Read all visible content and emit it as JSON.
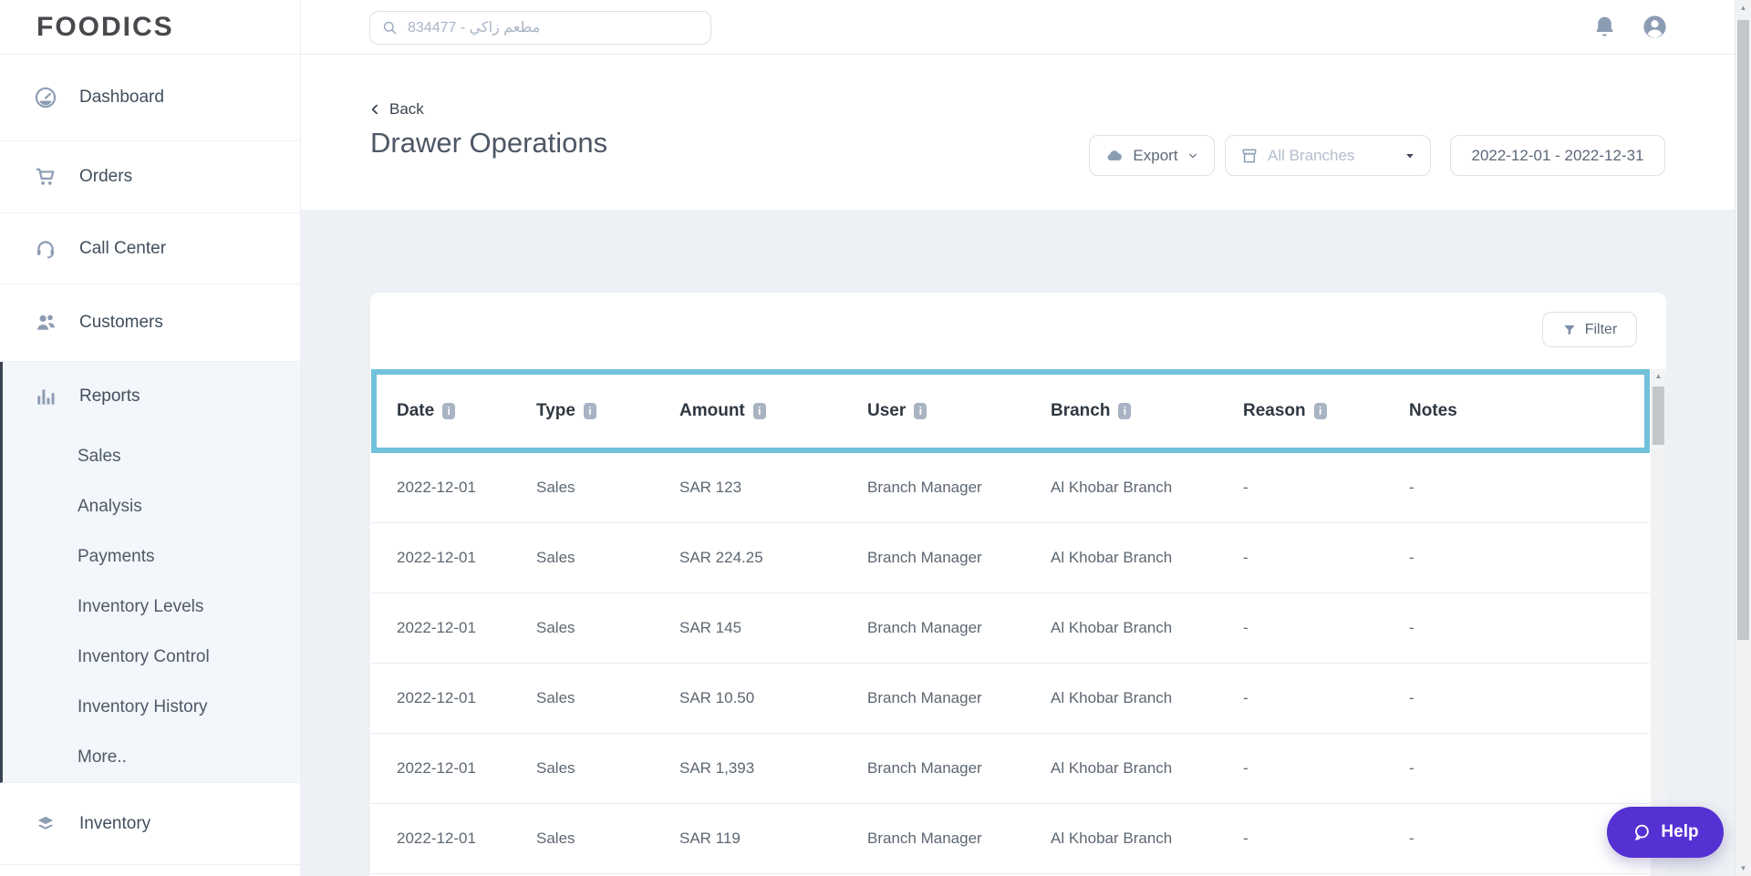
{
  "brand": {
    "logo_text": "FOODICS"
  },
  "topbar": {
    "search_placeholder": "مطعم زاكي - 834477"
  },
  "sidebar": {
    "items": [
      {
        "label": "Dashboard",
        "icon": "gauge-icon"
      },
      {
        "label": "Orders",
        "icon": "cart-icon"
      },
      {
        "label": "Call Center",
        "icon": "headset-icon"
      },
      {
        "label": "Customers",
        "icon": "customers-icon"
      },
      {
        "label": "Reports",
        "icon": "bar-chart-icon",
        "active": true,
        "children": [
          "Sales",
          "Analysis",
          "Payments",
          "Inventory Levels",
          "Inventory Control",
          "Inventory History",
          "More.."
        ]
      },
      {
        "label": "Inventory",
        "icon": "layers-icon"
      }
    ]
  },
  "header": {
    "back_label": "Back",
    "title": "Drawer Operations",
    "export_button": "Export",
    "branches_filter": "All Branches",
    "date_range": "2022-12-01 - 2022-12-31"
  },
  "table": {
    "filter_button": "Filter",
    "columns": [
      {
        "label": "Date",
        "info": true
      },
      {
        "label": "Type",
        "info": true
      },
      {
        "label": "Amount",
        "info": true
      },
      {
        "label": "User",
        "info": true
      },
      {
        "label": "Branch",
        "info": true
      },
      {
        "label": "Reason",
        "info": true
      },
      {
        "label": "Notes",
        "info": false
      }
    ],
    "rows": [
      [
        "2022-12-01",
        "Sales",
        "SAR 123",
        "Branch Manager",
        "Al Khobar Branch",
        "-",
        "-"
      ],
      [
        "2022-12-01",
        "Sales",
        "SAR 224.25",
        "Branch Manager",
        "Al Khobar Branch",
        "-",
        "-"
      ],
      [
        "2022-12-01",
        "Sales",
        "SAR 145",
        "Branch Manager",
        "Al Khobar Branch",
        "-",
        "-"
      ],
      [
        "2022-12-01",
        "Sales",
        "SAR 10.50",
        "Branch Manager",
        "Al Khobar Branch",
        "-",
        "-"
      ],
      [
        "2022-12-01",
        "Sales",
        "SAR 1,393",
        "Branch Manager",
        "Al Khobar Branch",
        "-",
        "-"
      ],
      [
        "2022-12-01",
        "Sales",
        "SAR 119",
        "Branch Manager",
        "Al Khobar Branch",
        "-",
        "-"
      ]
    ]
  },
  "help": {
    "label": "Help"
  },
  "colors": {
    "highlight_teal": "#71c1da",
    "help_purple": "#5531d4",
    "icon_gray": "#8c9cb3",
    "header_text": "#2f3842",
    "row_text": "#5d6772",
    "page_background": "#edf0f4"
  }
}
